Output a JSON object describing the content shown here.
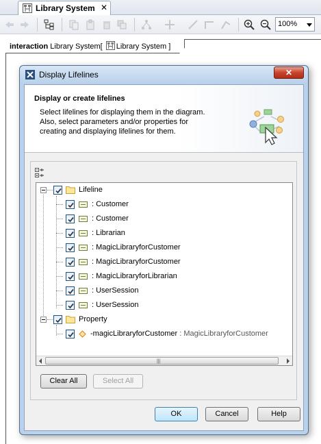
{
  "editor_tab": {
    "title": "Library System",
    "close": "✕"
  },
  "toolbar": {
    "zoom_value": "100%"
  },
  "frame": {
    "keyword": "interaction",
    "name": "Library System",
    "ref_name": "Library System",
    "open_bracket": "[",
    "close_bracket": "]"
  },
  "dialog": {
    "title": "Display Lifelines",
    "close": "✕",
    "header_title": "Display or create lifelines",
    "header_desc": [
      "Select lifelines for displaying them in the diagram.",
      "Also, select parameters and/or properties for",
      "creating and displaying lifelines for them."
    ],
    "tree": {
      "groups": [
        {
          "label": "Lifeline",
          "checked": true,
          "items": [
            {
              "label": ": Customer",
              "checked": true
            },
            {
              "label": ": Customer",
              "checked": true
            },
            {
              "label": ": Librarian",
              "checked": true
            },
            {
              "label": ": MagicLibraryforCustomer",
              "checked": true
            },
            {
              "label": ": MagicLibraryforCustomer",
              "checked": true
            },
            {
              "label": ": MagicLibraryforLibrarian",
              "checked": true
            },
            {
              "label": ": UserSession",
              "checked": true
            },
            {
              "label": ": UserSession",
              "checked": true
            }
          ]
        },
        {
          "label": "Property",
          "checked": true,
          "items": [
            {
              "name": "-magicLibraryforCustomer",
              "type": " : MagicLibraryforCustomer",
              "checked": true
            }
          ]
        }
      ]
    },
    "clear_all": "Clear All",
    "select_all": "Select All",
    "ok": "OK",
    "cancel": "Cancel",
    "help": "Help"
  }
}
